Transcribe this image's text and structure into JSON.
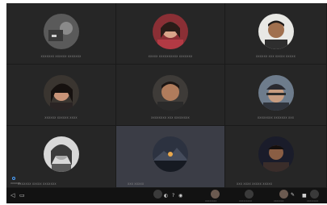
{
  "participants": [
    {
      "name": "XXXXXXX XXXXXX XXXXXXX",
      "avatar": "avatar-generic"
    },
    {
      "name": "XXXXX XXXXXXXXXX XXXXXXX",
      "avatar": "avatar-woman-red"
    },
    {
      "name": "XXXXXX XXX XXXXX XXXXX",
      "avatar": "avatar-man-light"
    },
    {
      "name": "XXXXXX XXXXXX XXXX",
      "avatar": "avatar-man-dark-hair"
    },
    {
      "name": "XXXXXXXX XXX XXXXXXXX",
      "avatar": "avatar-man-center"
    },
    {
      "name": "XXXXXXXX XXXXXXX XXX",
      "avatar": "avatar-man-cap"
    },
    {
      "name": "XXXXXXX XXXXX XXXXXXX",
      "avatar": "avatar-woman-bw"
    },
    {
      "name": "XXX XXXXX",
      "avatar": "avatar-landscape"
    },
    {
      "name": "XXX XXXX XXXXX XXXXX",
      "avatar": "avatar-man-night"
    }
  ],
  "toolbar": {
    "corner_text": "XXXXXX",
    "strip_labels": [
      "XXXXXXXX",
      "XXXXXXXXX",
      "XXXXXXX",
      "XXXXXXXX"
    ]
  },
  "accent": "#4da3ff"
}
